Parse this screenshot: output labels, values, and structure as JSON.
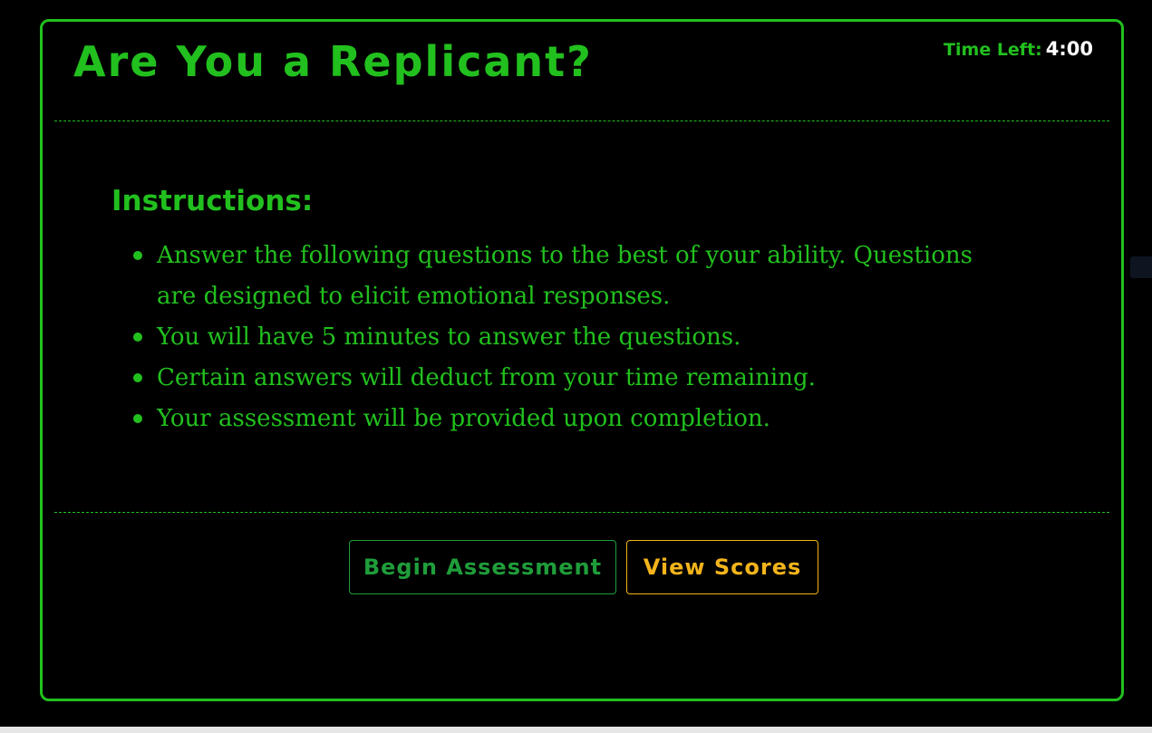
{
  "header": {
    "title": "Are You a Replicant?",
    "timer_label": "Time Left:",
    "timer_value": "4:00"
  },
  "instructions": {
    "heading": "Instructions:",
    "items": [
      "Answer the following questions to the best of your ability. Questions are designed to elicit emotional responses.",
      "You will have 5 minutes to answer the questions.",
      "Certain answers will deduct from your time remaining.",
      "Your assessment will be provided upon completion."
    ]
  },
  "actions": {
    "begin_label": "Begin Assessment",
    "scores_label": "View Scores"
  },
  "colors": {
    "accent_green": "#22c01e",
    "begin_button": "#1f9d3a",
    "scores_button": "#f3b41b",
    "timer_value": "#ffffff",
    "background": "#000000"
  }
}
